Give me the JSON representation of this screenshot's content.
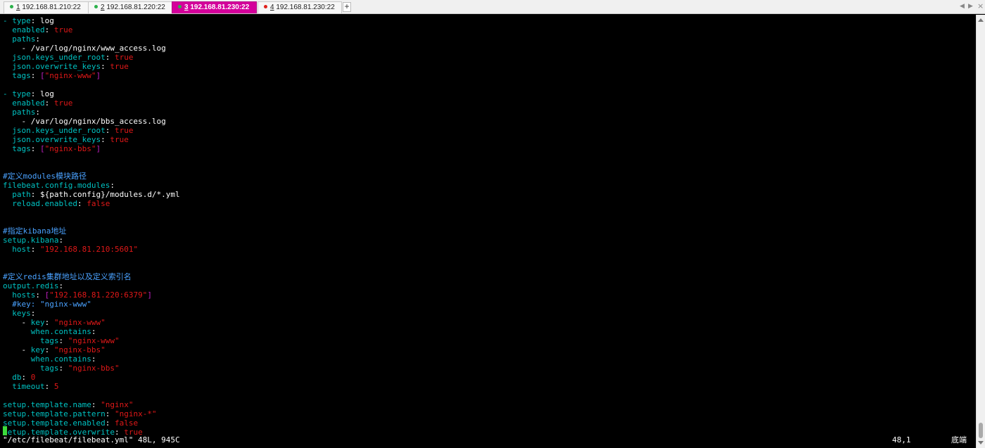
{
  "tabs": [
    {
      "num": "1",
      "host": "192.168.81.210:22",
      "dot": "#2bb14a",
      "active": false
    },
    {
      "num": "2",
      "host": "192.168.81.220:22",
      "dot": "#2bb14a",
      "active": false
    },
    {
      "num": "3",
      "host": "192.168.81.230:22",
      "dot": "#2bb14a",
      "active": true
    },
    {
      "num": "4",
      "host": "192.168.81.230:22",
      "dot": "#e0201b",
      "active": false
    }
  ],
  "tab_add_label": "+",
  "nav": {
    "prev": "◀",
    "next": "▶",
    "close": "×"
  },
  "lines": [
    [
      [
        "k",
        "- type"
      ],
      [
        "w",
        ": log"
      ]
    ],
    [
      [
        "k",
        "  enabled"
      ],
      [
        "w",
        ": "
      ],
      [
        "r",
        "true"
      ]
    ],
    [
      [
        "k",
        "  paths"
      ],
      [
        "w",
        ":"
      ]
    ],
    [
      [
        "w",
        "    - /var/log/nginx/www_access.log"
      ]
    ],
    [
      [
        "k",
        "  json.keys_under_root"
      ],
      [
        "w",
        ": "
      ],
      [
        "r",
        "true"
      ]
    ],
    [
      [
        "k",
        "  json.overwrite_keys"
      ],
      [
        "w",
        ": "
      ],
      [
        "r",
        "true"
      ]
    ],
    [
      [
        "k",
        "  tags"
      ],
      [
        "w",
        ": "
      ],
      [
        "m",
        "["
      ],
      [
        "r",
        "\"nginx-www\""
      ],
      [
        "m",
        "]"
      ]
    ],
    [],
    [
      [
        "k",
        "- type"
      ],
      [
        "w",
        ": log"
      ]
    ],
    [
      [
        "k",
        "  enabled"
      ],
      [
        "w",
        ": "
      ],
      [
        "r",
        "true"
      ]
    ],
    [
      [
        "k",
        "  paths"
      ],
      [
        "w",
        ":"
      ]
    ],
    [
      [
        "w",
        "    - /var/log/nginx/bbs_access.log"
      ]
    ],
    [
      [
        "k",
        "  json.keys_under_root"
      ],
      [
        "w",
        ": "
      ],
      [
        "r",
        "true"
      ]
    ],
    [
      [
        "k",
        "  json.overwrite_keys"
      ],
      [
        "w",
        ": "
      ],
      [
        "r",
        "true"
      ]
    ],
    [
      [
        "k",
        "  tags"
      ],
      [
        "w",
        ": "
      ],
      [
        "m",
        "["
      ],
      [
        "r",
        "\"nginx-bbs\""
      ],
      [
        "m",
        "]"
      ]
    ],
    [],
    [],
    [
      [
        "c",
        "#定义modules模块路径"
      ]
    ],
    [
      [
        "k",
        "filebeat.config.modules"
      ],
      [
        "w",
        ":"
      ]
    ],
    [
      [
        "k",
        "  path"
      ],
      [
        "w",
        ": ${path.config}/modules.d/*.yml"
      ]
    ],
    [
      [
        "k",
        "  reload.enabled"
      ],
      [
        "w",
        ": "
      ],
      [
        "r",
        "false"
      ]
    ],
    [],
    [],
    [
      [
        "c",
        "#指定kibana地址"
      ]
    ],
    [
      [
        "k",
        "setup.kibana"
      ],
      [
        "w",
        ":"
      ]
    ],
    [
      [
        "k",
        "  host"
      ],
      [
        "w",
        ": "
      ],
      [
        "r",
        "\"192.168.81.210:5601\""
      ]
    ],
    [],
    [],
    [
      [
        "c",
        "#定义redis集群地址以及定义索引名"
      ]
    ],
    [
      [
        "k",
        "output.redis"
      ],
      [
        "w",
        ":"
      ]
    ],
    [
      [
        "k",
        "  hosts"
      ],
      [
        "w",
        ": "
      ],
      [
        "m",
        "["
      ],
      [
        "r",
        "\"192.168.81.220:6379\""
      ],
      [
        "m",
        "]"
      ]
    ],
    [
      [
        "c",
        "  #key: \"nginx-www\""
      ]
    ],
    [
      [
        "k",
        "  keys"
      ],
      [
        "w",
        ":"
      ]
    ],
    [
      [
        "w",
        "    - "
      ],
      [
        "k",
        "key"
      ],
      [
        "w",
        ": "
      ],
      [
        "r",
        "\"nginx-www\""
      ]
    ],
    [
      [
        "k",
        "      when.contains"
      ],
      [
        "w",
        ":"
      ]
    ],
    [
      [
        "k",
        "        tags"
      ],
      [
        "w",
        ": "
      ],
      [
        "r",
        "\"nginx-www\""
      ]
    ],
    [
      [
        "w",
        "    - "
      ],
      [
        "k",
        "key"
      ],
      [
        "w",
        ": "
      ],
      [
        "r",
        "\"nginx-bbs\""
      ]
    ],
    [
      [
        "k",
        "      when.contains"
      ],
      [
        "w",
        ":"
      ]
    ],
    [
      [
        "k",
        "        tags"
      ],
      [
        "w",
        ": "
      ],
      [
        "r",
        "\"nginx-bbs\""
      ]
    ],
    [
      [
        "k",
        "  db"
      ],
      [
        "w",
        ": "
      ],
      [
        "r",
        "0"
      ]
    ],
    [
      [
        "k",
        "  timeout"
      ],
      [
        "w",
        ": "
      ],
      [
        "r",
        "5"
      ]
    ],
    [],
    [
      [
        "k",
        "setup.template.name"
      ],
      [
        "w",
        ": "
      ],
      [
        "r",
        "\"nginx\""
      ]
    ],
    [
      [
        "k",
        "setup.template.pattern"
      ],
      [
        "w",
        ": "
      ],
      [
        "r",
        "\"nginx-*\""
      ]
    ],
    [
      [
        "k",
        "setup.template.enabled"
      ],
      [
        "w",
        ": "
      ],
      [
        "r",
        "false"
      ]
    ],
    [
      [
        "k",
        "setup.template.overwrite"
      ],
      [
        "w",
        ": "
      ],
      [
        "r",
        "true"
      ]
    ]
  ],
  "status_line": "\"/etc/filebeat/filebeat.yml\" 48L, 945C",
  "cursor_pos": "48,1",
  "scroll_pos": "底端"
}
